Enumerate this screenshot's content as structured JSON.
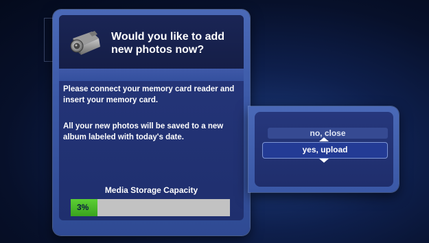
{
  "dialog": {
    "title": "Would you like to add new photos now?",
    "message_1": "Please connect your memory card reader and insert your memory card.",
    "message_2": "All your new photos will be saved to a new album labeled with today's date.",
    "icon": "camera-icon"
  },
  "storage": {
    "label": "Media Storage Capacity",
    "percent_text": "3%",
    "fill_fraction": 0.17,
    "fill_color": "#4cbf2a",
    "track_color": "#c2c2c2"
  },
  "options": {
    "items": [
      {
        "label": "no, close",
        "selected": false
      },
      {
        "label": "yes, upload",
        "selected": true
      }
    ],
    "icons": [
      "arrow-up-icon",
      "arrow-down-icon"
    ]
  },
  "colors": {
    "panel_frame": "#4a69b7",
    "panel_inner": "#26377c",
    "background": "#0e1f4c"
  }
}
